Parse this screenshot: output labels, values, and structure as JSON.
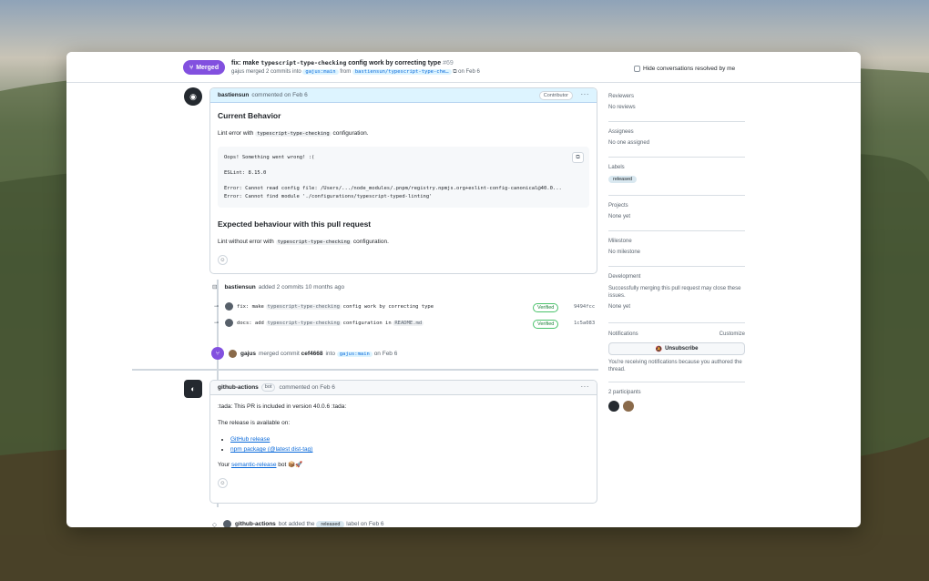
{
  "header": {
    "status_badge": "Merged",
    "title_prefix": "fix: make",
    "title_code": "typescript-type-checking",
    "title_suffix": "config work by correcting type",
    "pr_number": "#69",
    "sub_user": "gajus",
    "sub_text": "merged 2 commits into",
    "base_branch": "gajus:main",
    "sub_from": "from",
    "head_branch": "bastiensun/typescript-type-che…",
    "sub_date": "on Feb 6",
    "hide_resolved": "Hide conversations resolved by me"
  },
  "comment1": {
    "author": "bastiensun",
    "meta": "commented on Feb 6",
    "role": "Contributor",
    "h_current": "Current Behavior",
    "p1_before": "Lint error with",
    "p1_code": "typescript-type-checking",
    "p1_after": "configuration.",
    "code_lines": "Oops! Something went wrong! :(\n\nESLint: 8.15.0\n\nError: Cannot read config file: /Users/.../node_modules/.pnpm/registry.npmjs.org+eslint-config-canonical@40.0...\nError: Cannot find module './configurations/typescript-typed-linting'",
    "h_expected": "Expected behaviour with this pull request",
    "p2_before": "Lint without error with",
    "p2_code": "typescript-type-checking",
    "p2_after": "configuration."
  },
  "commits_event": {
    "author": "bastiensun",
    "text": "added 2 commits",
    "time": "10 months ago",
    "commits": [
      {
        "prefix": "fix: make",
        "code": "typescript-type-checking",
        "suffix": "config work by correcting type",
        "badge": "Verified",
        "sha": "9494fcc"
      },
      {
        "prefix": "docs: add",
        "code": "typescript-type-checking",
        "suffix": "configuration in",
        "code2": "README.md",
        "badge": "Verified",
        "sha": "1c5a083"
      }
    ]
  },
  "merge_event": {
    "author": "gajus",
    "text": "merged commit",
    "sha": "cef4668",
    "into": "into",
    "branch": "gajus:main",
    "date": "on Feb 6"
  },
  "comment2": {
    "author": "github-actions",
    "bot": "bot",
    "meta": "commented on Feb 6",
    "p1": ":tada: This PR is included in version 40.0.6 :tada:",
    "p2": "The release is available on:",
    "links": [
      "GitHub release",
      "npm package (@latest dist-tag)"
    ],
    "p3_before": "Your",
    "p3_link": "semantic-release",
    "p3_after": "bot 📦🚀"
  },
  "next_event": {
    "author": "github-actions",
    "text": "bot added the",
    "label": "released",
    "after": "label on Feb 6"
  },
  "sidebar": {
    "reviewers_title": "Reviewers",
    "reviewers_val": "No reviews",
    "assignees_title": "Assignees",
    "assignees_val": "No one assigned",
    "labels_title": "Labels",
    "labels_val": "released",
    "projects_title": "Projects",
    "projects_val": "None yet",
    "milestone_title": "Milestone",
    "milestone_val": "No milestone",
    "development_title": "Development",
    "development_desc": "Successfully merging this pull request may close these issues.",
    "development_val": "None yet",
    "notifications_title": "Notifications",
    "customize": "Customize",
    "unsubscribe": "Unsubscribe",
    "notif_desc": "You're receiving notifications because you authored the thread.",
    "participants": "2 participants"
  },
  "colors": {
    "merged": "#8250df",
    "link": "#0969da",
    "verified": "#1a7f37"
  }
}
